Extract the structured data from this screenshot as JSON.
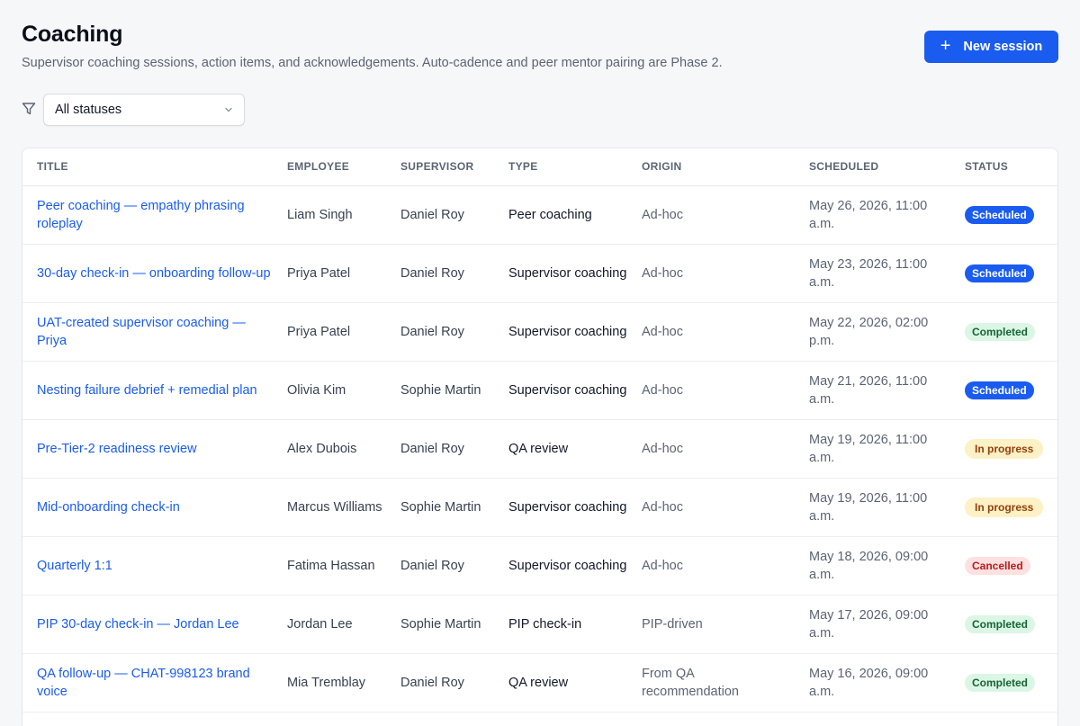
{
  "header": {
    "title": "Coaching",
    "subtitle": "Supervisor coaching sessions, action items, and acknowledgements. Auto-cadence and peer mentor pairing are Phase 2.",
    "new_button_icon": "+",
    "new_button_label": "New session"
  },
  "filter": {
    "icon": "filter-icon",
    "selected": "All statuses"
  },
  "table": {
    "columns": [
      "TITLE",
      "EMPLOYEE",
      "SUPERVISOR",
      "TYPE",
      "ORIGIN",
      "SCHEDULED",
      "STATUS"
    ],
    "rows": [
      {
        "title": "Peer coaching — empathy phrasing roleplay",
        "employee": "Liam Singh",
        "supervisor": "Daniel Roy",
        "type": "Peer coaching",
        "origin": "Ad-hoc",
        "scheduled": "May 26, 2026, 11:00 a.m.",
        "status": "Scheduled",
        "status_kind": "scheduled"
      },
      {
        "title": "30-day check-in — onboarding follow-up",
        "employee": "Priya Patel",
        "supervisor": "Daniel Roy",
        "type": "Supervisor coaching",
        "origin": "Ad-hoc",
        "scheduled": "May 23, 2026, 11:00 a.m.",
        "status": "Scheduled",
        "status_kind": "scheduled"
      },
      {
        "title": "UAT-created supervisor coaching — Priya",
        "employee": "Priya Patel",
        "supervisor": "Daniel Roy",
        "type": "Supervisor coaching",
        "origin": "Ad-hoc",
        "scheduled": "May 22, 2026, 02:00 p.m.",
        "status": "Completed",
        "status_kind": "completed"
      },
      {
        "title": "Nesting failure debrief + remedial plan",
        "employee": "Olivia Kim",
        "supervisor": "Sophie Martin",
        "type": "Supervisor coaching",
        "origin": "Ad-hoc",
        "scheduled": "May 21, 2026, 11:00 a.m.",
        "status": "Scheduled",
        "status_kind": "scheduled"
      },
      {
        "title": "Pre-Tier-2 readiness review",
        "employee": "Alex Dubois",
        "supervisor": "Daniel Roy",
        "type": "QA review",
        "origin": "Ad-hoc",
        "scheduled": "May 19, 2026, 11:00 a.m.",
        "status": "In progress",
        "status_kind": "inprogress"
      },
      {
        "title": "Mid-onboarding check-in",
        "employee": "Marcus Williams",
        "supervisor": "Sophie Martin",
        "type": "Supervisor coaching",
        "origin": "Ad-hoc",
        "scheduled": "May 19, 2026, 11:00 a.m.",
        "status": "In progress",
        "status_kind": "inprogress"
      },
      {
        "title": "Quarterly 1:1",
        "employee": "Fatima Hassan",
        "supervisor": "Daniel Roy",
        "type": "Supervisor coaching",
        "origin": "Ad-hoc",
        "scheduled": "May 18, 2026, 09:00 a.m.",
        "status": "Cancelled",
        "status_kind": "cancelled"
      },
      {
        "title": "PIP 30-day check-in — Jordan Lee",
        "employee": "Jordan Lee",
        "supervisor": "Sophie Martin",
        "type": "PIP check-in",
        "origin": "PIP-driven",
        "scheduled": "May 17, 2026, 09:00 a.m.",
        "status": "Completed",
        "status_kind": "completed"
      },
      {
        "title": "QA follow-up — CHAT-998123 brand voice",
        "employee": "Mia Tremblay",
        "supervisor": "Daniel Roy",
        "type": "QA review",
        "origin": "From QA recommendation",
        "scheduled": "May 16, 2026, 09:00 a.m.",
        "status": "Completed",
        "status_kind": "completed"
      }
    ]
  }
}
